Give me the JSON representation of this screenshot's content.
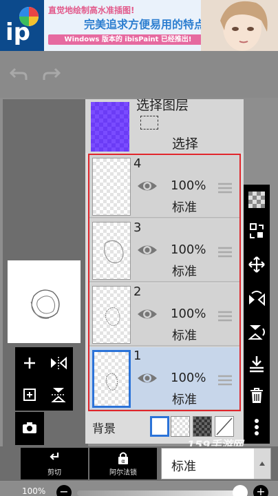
{
  "ad": {
    "line1": "直觉地绘制高水准插图!",
    "line2": "完美追求方便易用的特点!",
    "line3": "Windows 版本的 ibisPaint 已经推出!"
  },
  "selection_layer": {
    "title": "选择图层",
    "label": "选择"
  },
  "layers": [
    {
      "number": "4",
      "opacity": "100%",
      "mode": "标准",
      "selected": false
    },
    {
      "number": "3",
      "opacity": "100%",
      "mode": "标准",
      "selected": false
    },
    {
      "number": "2",
      "opacity": "100%",
      "mode": "标准",
      "selected": false
    },
    {
      "number": "1",
      "opacity": "100%",
      "mode": "标准",
      "selected": true
    }
  ],
  "background": {
    "label": "背景",
    "swatches": [
      "white",
      "checker",
      "dark-checker",
      "none"
    ]
  },
  "bottom": {
    "clip_label": "剪切",
    "alpha_lock_label": "阿尔法锁",
    "blend_mode": "标准"
  },
  "opacity_slider": {
    "value_label": "100%",
    "value": 1.0
  },
  "watermark": "159手游网",
  "colors": {
    "selection_accent": "#2b73d8",
    "frame_red": "#e0242a",
    "selection_layer_fill": "#7a4cff"
  }
}
